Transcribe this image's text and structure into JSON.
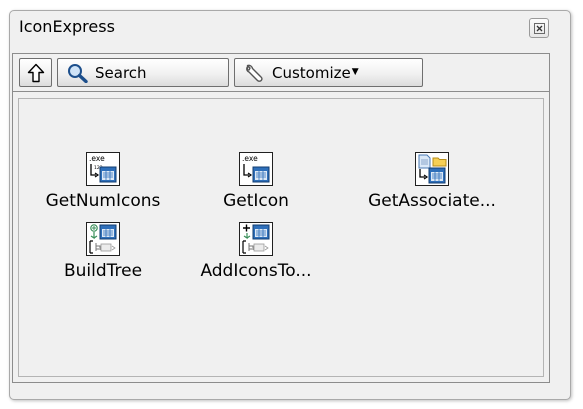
{
  "window": {
    "title": "IconExpress"
  },
  "toolbar": {
    "search_label": "Search",
    "customize_label": "Customize"
  },
  "items": [
    {
      "label": "GetNumIcons",
      "icon": "exe-count-icon"
    },
    {
      "label": "GetIcon",
      "icon": "exe-get-icon"
    },
    {
      "label": "GetAssociate...",
      "icon": "document-folder-icon"
    },
    {
      "label": "BuildTree",
      "icon": "build-tree-icon"
    },
    {
      "label": "AddIconsTo...",
      "icon": "add-icons-tree-icon"
    }
  ],
  "icon_text": {
    "exe": ".exe",
    "count": "123"
  },
  "colors": {
    "palette_bg": "#f0f0f0",
    "toolbar_border": "#6f6f6f",
    "icon_blue": "#2e6fba",
    "icon_green": "#3a8f5a"
  }
}
